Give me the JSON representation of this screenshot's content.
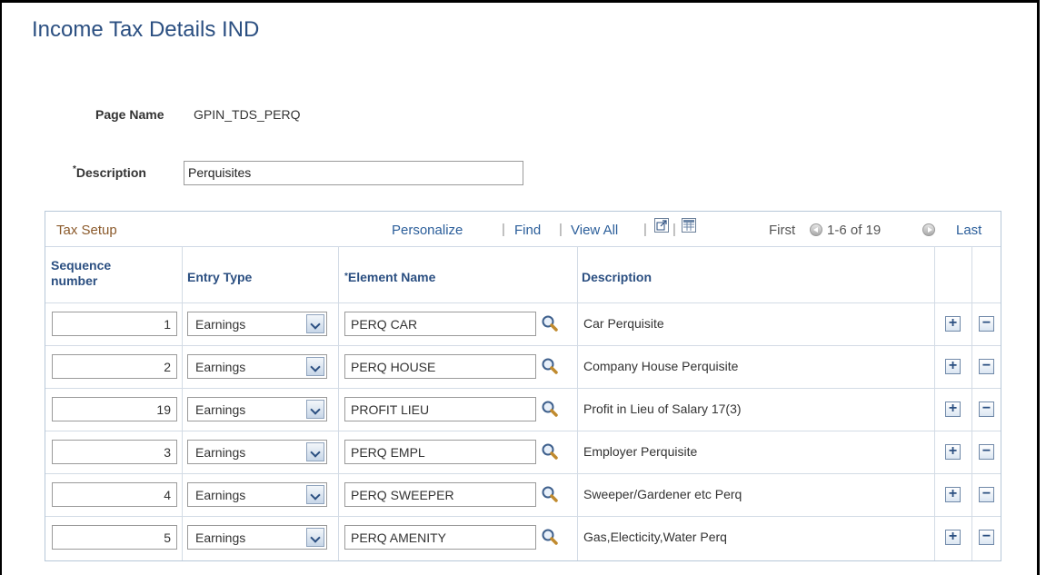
{
  "page": {
    "title": "Income Tax Details IND",
    "page_name_label": "Page Name",
    "page_name_value": "GPIN_TDS_PERQ",
    "description_required_mark": "*",
    "description_label": "Description",
    "description_value": "Perquisites"
  },
  "grid": {
    "title": "Tax Setup",
    "personalize": "Personalize",
    "find": "Find",
    "view_all": "View All",
    "sep": "|",
    "first": "First",
    "range": "1-6 of 19",
    "last": "Last",
    "columns": {
      "seq_line1": "Sequence",
      "seq_line2": "number",
      "entry_type": "Entry Type",
      "element_req": "*",
      "element_name": "Element Name",
      "description": "Description"
    },
    "rows": [
      {
        "seq": "1",
        "entry_type": "Earnings",
        "element": "PERQ CAR",
        "description": "Car Perquisite"
      },
      {
        "seq": "2",
        "entry_type": "Earnings",
        "element": "PERQ HOUSE",
        "description": "Company House Perquisite"
      },
      {
        "seq": "19",
        "entry_type": "Earnings",
        "element": "PROFIT LIEU",
        "description": "Profit in Lieu of Salary 17(3)"
      },
      {
        "seq": "3",
        "entry_type": "Earnings",
        "element": "PERQ EMPL",
        "description": "Employer Perquisite"
      },
      {
        "seq": "4",
        "entry_type": "Earnings",
        "element": "PERQ SWEEPER",
        "description": "Sweeper/Gardener etc Perq"
      },
      {
        "seq": "5",
        "entry_type": "Earnings",
        "element": "PERQ AMENITY",
        "description": "Gas,Electicity,Water Perq"
      }
    ],
    "add_symbol": "+",
    "delete_symbol": "−"
  }
}
